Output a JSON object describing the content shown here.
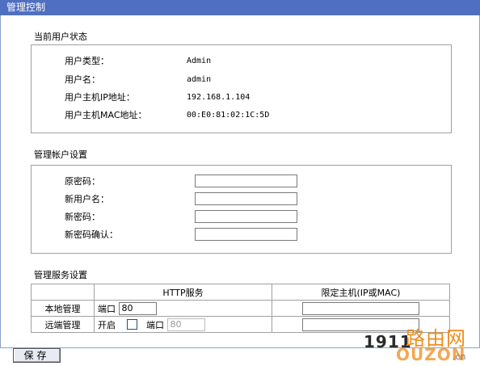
{
  "window": {
    "title": "管理控制"
  },
  "status": {
    "heading": "当前用户状态",
    "rows": [
      {
        "label": "用户类型：",
        "value": "Admin"
      },
      {
        "label": "用户名：",
        "value": "admin"
      },
      {
        "label": "用户主机IP地址：",
        "value": "192.168.1.104"
      },
      {
        "label": "用户主机MAC地址：",
        "value": "00:E0:81:02:1C:5D"
      }
    ]
  },
  "account": {
    "heading": "管理帐户设置",
    "fields": [
      {
        "label": "原密码：",
        "value": ""
      },
      {
        "label": "新用户名：",
        "value": ""
      },
      {
        "label": "新密码：",
        "value": ""
      },
      {
        "label": "新密码确认：",
        "value": ""
      }
    ]
  },
  "service": {
    "heading": "管理服务设置",
    "col_http": "HTTP服务",
    "col_host": "限定主机(IP或MAC)",
    "local": {
      "name": "本地管理",
      "port_label": "端口",
      "port_value": "80",
      "host_value": ""
    },
    "remote": {
      "name": "远端管理",
      "enable_label": "开启",
      "enabled": false,
      "port_label": "端口",
      "port_value": "80",
      "host_value": ""
    }
  },
  "toolbar": {
    "save_label": "保存"
  },
  "watermark": {
    "number": "1911",
    "cn": "路由网",
    "brand": "OUZON",
    "domain": ".cn"
  }
}
